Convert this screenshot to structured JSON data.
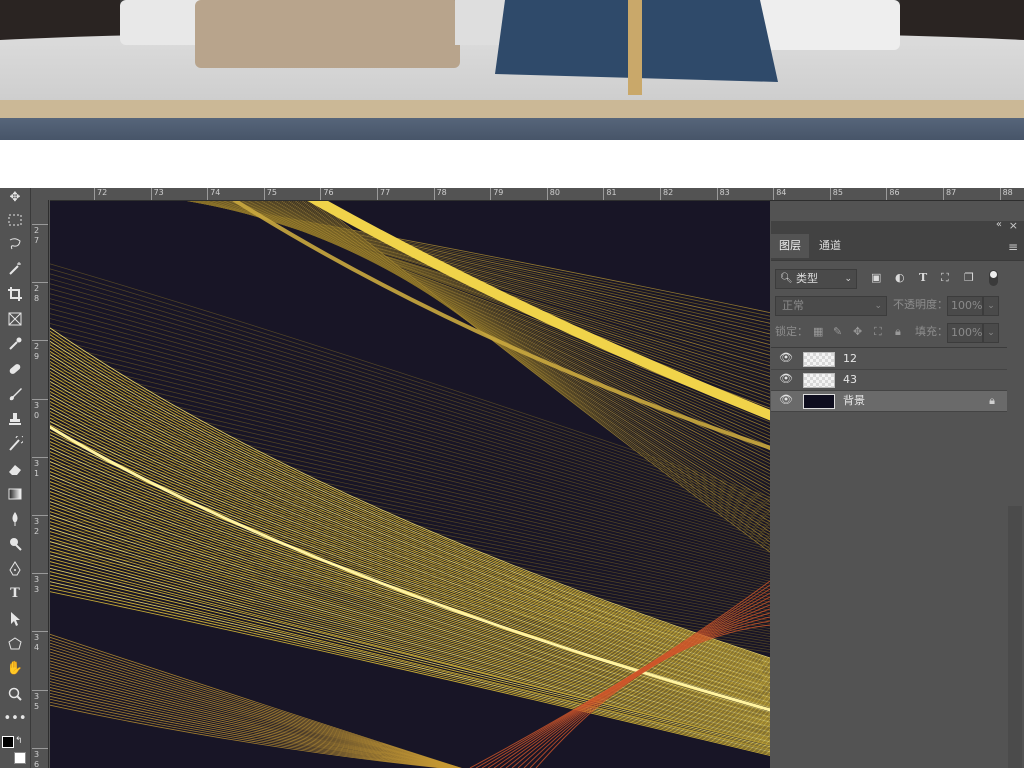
{
  "photo": {
    "description_alt": ""
  },
  "ruler": {
    "h_ticks": [
      "72",
      "73",
      "74",
      "75",
      "76",
      "77",
      "78",
      "79",
      "80",
      "81",
      "82",
      "83",
      "84",
      "85",
      "86",
      "87",
      "88"
    ],
    "v_ticks": [
      "2\n7",
      "2\n8",
      "2\n9",
      "3\n0",
      "3\n1",
      "3\n2",
      "3\n3",
      "3\n4",
      "3\n5",
      "3\n6"
    ]
  },
  "toolbar": {
    "tools": [
      "move",
      "marquee",
      "lasso",
      "magic-wand",
      "crop",
      "frame",
      "eyedropper",
      "healing",
      "brush",
      "stamp",
      "history-brush",
      "eraser",
      "gradient",
      "blur",
      "dodge",
      "pen",
      "type",
      "path-select",
      "shape",
      "hand",
      "zoom",
      "more"
    ]
  },
  "layers_panel": {
    "tab_layers": "图层",
    "tab_channels": "通道",
    "filter_type": "类型",
    "blend_mode": "正常",
    "opacity_label": "不透明度：",
    "opacity_value": "100%",
    "lock_label": "锁定：",
    "fill_label": "填充：",
    "fill_value": "100%",
    "panel_menu_icon": "≡",
    "collapse_icon": "«",
    "close_icon": "×",
    "layers": [
      {
        "name": "12",
        "thumb": "transparent",
        "selected": false,
        "locked": false
      },
      {
        "name": "43",
        "thumb": "transparent",
        "selected": false,
        "locked": false
      },
      {
        "name": "背景",
        "thumb": "dark",
        "selected": true,
        "locked": true
      }
    ]
  },
  "colors": {
    "ui_bg": "#535353",
    "canvas_bg": "#1a1728",
    "gold": "#e8c640"
  }
}
